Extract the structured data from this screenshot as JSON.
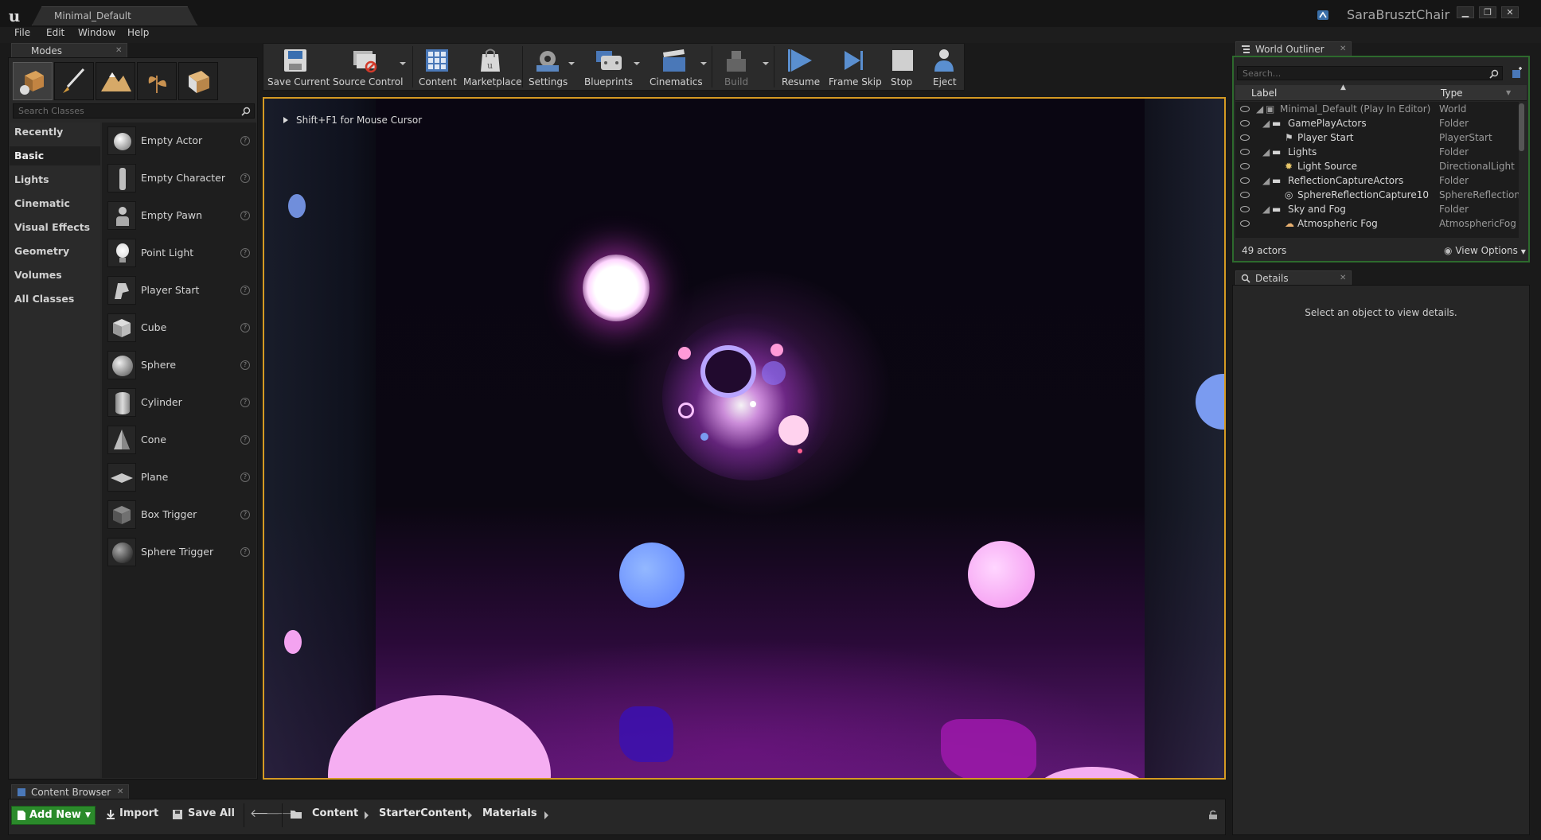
{
  "window": {
    "document_tab": "Minimal_Default",
    "user": "SaraBrusztChair"
  },
  "menu": [
    "File",
    "Edit",
    "Window",
    "Help"
  ],
  "modes": {
    "tab": "Modes",
    "search_placeholder": "Search Classes",
    "categories": [
      "Recently Placed",
      "Basic",
      "Lights",
      "Cinematic",
      "Visual Effects",
      "Geometry",
      "Volumes",
      "All Classes"
    ],
    "active_category": "Basic",
    "items": [
      "Empty Actor",
      "Empty Character",
      "Empty Pawn",
      "Point Light",
      "Player Start",
      "Cube",
      "Sphere",
      "Cylinder",
      "Cone",
      "Plane",
      "Box Trigger",
      "Sphere Trigger"
    ]
  },
  "toolbar": {
    "buttons": [
      "Save Current",
      "Source Control",
      "Content",
      "Marketplace",
      "Settings",
      "Blueprints",
      "Cinematics",
      "Build",
      "Resume",
      "Frame Skip",
      "Stop",
      "Eject"
    ]
  },
  "viewport": {
    "hint": "Shift+F1 for Mouse Cursor"
  },
  "outliner": {
    "tab": "World Outliner",
    "search_placeholder": "Search...",
    "col_label": "Label",
    "col_type": "Type",
    "rows": [
      {
        "label": "Minimal_Default (Play In Editor)",
        "type": "World"
      },
      {
        "label": "GamePlayActors",
        "type": "Folder"
      },
      {
        "label": "Player Start",
        "type": "PlayerStart"
      },
      {
        "label": "Lights",
        "type": "Folder"
      },
      {
        "label": "Light Source",
        "type": "DirectionalLight"
      },
      {
        "label": "ReflectionCaptureActors",
        "type": "Folder"
      },
      {
        "label": "SphereReflectionCapture10",
        "type": "SphereReflectionC"
      },
      {
        "label": "Sky and Fog",
        "type": "Folder"
      },
      {
        "label": "Atmospheric Fog",
        "type": "AtmosphericFog"
      }
    ],
    "count": "49 actors",
    "view_options": "View Options"
  },
  "details": {
    "tab": "Details",
    "empty_message": "Select an object to view details."
  },
  "content_browser": {
    "tab": "Content Browser",
    "add_new": "Add New",
    "import": "Import",
    "save_all": "Save All",
    "path": [
      "Content",
      "StarterContent",
      "Materials"
    ]
  },
  "colors": {
    "accent_green": "#2b8a2b",
    "viewport_border": "#d59a23"
  }
}
